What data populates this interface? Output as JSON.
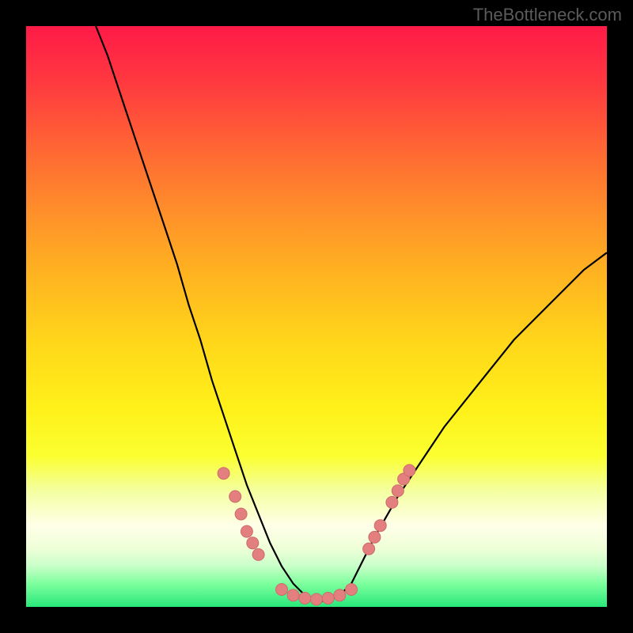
{
  "watermark": {
    "text": "TheBottleneck.com"
  },
  "colors": {
    "background": "#000000",
    "curve_stroke": "#000000",
    "marker_fill": "#e37f7f",
    "marker_stroke": "#cc6b6b",
    "gradient_top": "#ff1a47",
    "gradient_bottom": "#28e87a"
  },
  "chart_data": {
    "type": "line",
    "title": "",
    "xlabel": "",
    "ylabel": "",
    "xlim": [
      0,
      100
    ],
    "ylim": [
      0,
      100
    ],
    "grid": false,
    "legend": false,
    "series": [
      {
        "name": "bottleneck-curve",
        "comment": "y = bottleneck % (0 bottom, 100 top) vs x position; V-shaped well",
        "x": [
          12,
          14,
          16,
          18,
          20,
          22,
          24,
          26,
          28,
          30,
          32,
          34,
          36,
          38,
          40,
          42,
          44,
          46,
          48,
          50,
          52,
          54,
          56,
          58,
          60,
          64,
          68,
          72,
          76,
          80,
          84,
          88,
          92,
          96,
          100
        ],
        "y": [
          100,
          95,
          89,
          83,
          77,
          71,
          65,
          59,
          52,
          46,
          39,
          33,
          27,
          21,
          16,
          11,
          7,
          4,
          2,
          1,
          1,
          2,
          4,
          8,
          12,
          19,
          25,
          31,
          36,
          41,
          46,
          50,
          54,
          58,
          61
        ]
      }
    ],
    "markers": {
      "comment": "salmon dots overlaid on curve near the bottom of the well",
      "points": [
        {
          "x": 34,
          "y": 23
        },
        {
          "x": 36,
          "y": 19
        },
        {
          "x": 37,
          "y": 16
        },
        {
          "x": 38,
          "y": 13
        },
        {
          "x": 39,
          "y": 11
        },
        {
          "x": 40,
          "y": 9
        },
        {
          "x": 44,
          "y": 3
        },
        {
          "x": 46,
          "y": 2
        },
        {
          "x": 48,
          "y": 1.5
        },
        {
          "x": 50,
          "y": 1.3
        },
        {
          "x": 52,
          "y": 1.5
        },
        {
          "x": 54,
          "y": 2
        },
        {
          "x": 56,
          "y": 3
        },
        {
          "x": 59,
          "y": 10
        },
        {
          "x": 60,
          "y": 12
        },
        {
          "x": 61,
          "y": 14
        },
        {
          "x": 63,
          "y": 18
        },
        {
          "x": 64,
          "y": 20
        },
        {
          "x": 65,
          "y": 22
        },
        {
          "x": 66,
          "y": 23.5
        }
      ]
    }
  }
}
